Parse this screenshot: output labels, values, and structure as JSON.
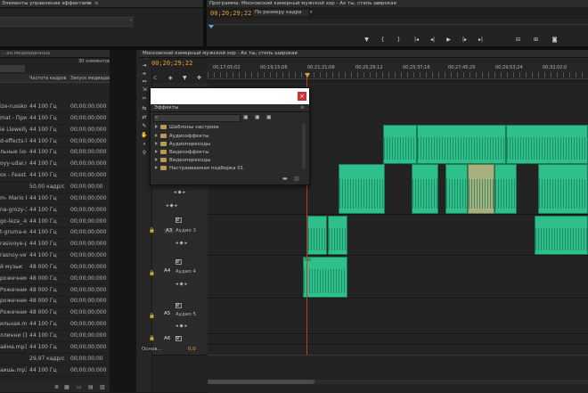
{
  "effect_controls": {
    "tab": "Элементы управления эффектами",
    "close": "×",
    "menu": "≡"
  },
  "program_monitor": {
    "tab": "Программа: Московский камерный мужской хор - Ах ты, степь широкая",
    "menu": "≡",
    "timecode": "00;20;29;22",
    "fit": "По размеру кадра",
    "buttons": [
      "marker",
      "in",
      "out",
      "go-in",
      "step-back",
      "play",
      "step-fwd",
      "go-out",
      "insert",
      "overwrite",
      "export-frame"
    ]
  },
  "project": {
    "tab": "...ен.медиаданных",
    "count": "30 элементов",
    "col_rate": "Частота кадров",
    "col_start": "Запуск медиадан",
    "rows": [
      {
        "name": "ize-russkoe",
        "rate": "44 100 Гц",
        "start": "00;00;00;000"
      },
      {
        "name": "mat - При",
        "rate": "44 100 Гц",
        "start": "00;00;00;000"
      },
      {
        "name": "ie Llewelly",
        "rate": "44 100 Гц",
        "start": "00;00;00;000"
      },
      {
        "name": "d-effects-li",
        "rate": "44 100 Гц",
        "start": "00;00;00;000"
      },
      {
        "name": "льные (ю-гра",
        "rate": "44 100 Гц",
        "start": "00;00;00;000"
      },
      {
        "name": "oyy-udar.mp",
        "rate": "44 100 Гц",
        "start": "00;00;00;000"
      },
      {
        "name": "ox - Feast.",
        "rate": "44 100 Гц",
        "start": "00;00;00;000"
      },
      {
        "name": "",
        "rate": "50,00 кадр/с",
        "start": "00;00;00;00"
      },
      {
        "name": "m- Mario Kal",
        "rate": "44 100 Гц",
        "start": "00;00;00;000"
      },
      {
        "name": "na-grozy-3",
        "rate": "44 100 Гц",
        "start": "00;00;00;000"
      },
      {
        "name": "go-leza_-k",
        "rate": "44 100 Гц",
        "start": "00;00;00;000"
      },
      {
        "name": "t-gruma-e",
        "rate": "44 100 Гц",
        "start": "00;00;00;000"
      },
      {
        "name": "rasivoye-p",
        "rate": "44 100 Гц",
        "start": "00;00;00;000"
      },
      {
        "name": "rasnoy-veter",
        "rate": "44 100 Гц",
        "start": "00;00;00;000"
      },
      {
        "name": "й музык",
        "rate": "48 000 Гц",
        "start": "00;00;00;000"
      },
      {
        "name": "рожечники",
        "rate": "48 000 Гц",
        "start": "00;00;00;000"
      },
      {
        "name": "Рожечники",
        "rate": "48 000 Гц",
        "start": "00;00;00;000"
      },
      {
        "name": "рожечники",
        "rate": "48 000 Гц",
        "start": "00;00;00;000"
      },
      {
        "name": "Рожечники",
        "rate": "48 000 Гц",
        "start": "00;00;00;000"
      },
      {
        "name": "ильная.mp3",
        "rate": "44 100 Гц",
        "start": "00;00;00;000"
      },
      {
        "name": "ллинни (1).m",
        "rate": "44 100 Гц",
        "start": "00;00;00;000"
      },
      {
        "name": "айма.mp3",
        "rate": "44 100 Гц",
        "start": "00;00;00;000"
      },
      {
        "name": "",
        "rate": "29,97 кадр/с",
        "start": "00;00;00;00"
      },
      {
        "name": "аишь.mp3",
        "rate": "44 100 Гц",
        "start": "00;00;00;000"
      }
    ]
  },
  "timeline": {
    "tab": "Московский камерный мужской хор - Ах ты, степь широкая",
    "timecode": "00;20;29;22",
    "ruler": [
      "00;17;05;02",
      "00;19;15;06",
      "00;21;21;08",
      "00;25;29;12",
      "00;25;37;16",
      "00;27;45;20",
      "00;29;53;24",
      "00;32;02;0"
    ],
    "tracks": {
      "a3": {
        "id": "A3",
        "name": "Аудио 3"
      },
      "a4": {
        "id": "A4",
        "name": "Аудио 4"
      },
      "a5": {
        "id": "A5",
        "name": "Аудио 5"
      },
      "a6": {
        "id": "A6"
      },
      "master": {
        "name": "Основ...",
        "value": "0,0"
      }
    },
    "m": "M",
    "s": "S",
    "clip_labels": {
      "po": "По"
    }
  },
  "effects_panel": {
    "tab": "Эффекты",
    "items": [
      "Шаблоны настроек",
      "Аудиоэффекты",
      "Аудиопереходы",
      "Видеоэффекты",
      "Видеопереходы",
      "Настраиваемая подборка 01"
    ]
  },
  "colors": {
    "accent": "#e6a13a",
    "clip": "#2fbf8a",
    "playhead": "#c0392b",
    "close": "#cc3333"
  }
}
